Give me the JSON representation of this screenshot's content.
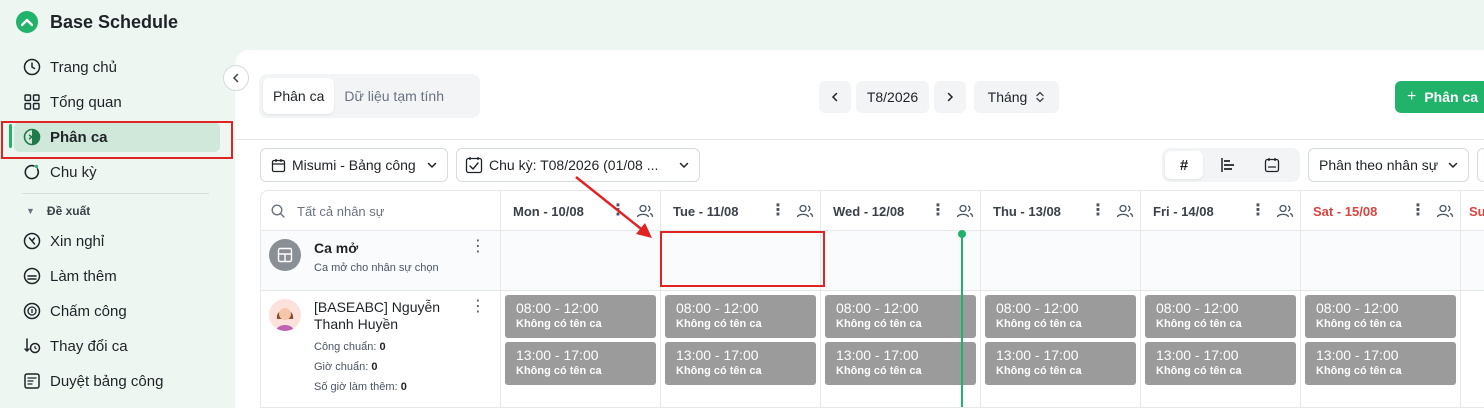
{
  "app": {
    "title": "Base Schedule"
  },
  "sidebar": {
    "items": [
      {
        "label": "Trang chủ",
        "icon": "clock-icon"
      },
      {
        "label": "Tổng quan",
        "icon": "grid-icon"
      },
      {
        "label": "Phân ca",
        "icon": "shift-icon",
        "active": true
      },
      {
        "label": "Chu kỳ",
        "icon": "cycle-icon"
      }
    ],
    "section_label": "Đề xuất",
    "section_items": [
      {
        "label": "Xin nghỉ",
        "icon": "leave-icon"
      },
      {
        "label": "Làm thêm",
        "icon": "overtime-icon"
      },
      {
        "label": "Chấm công",
        "icon": "timekeeping-icon"
      },
      {
        "label": "Thay đổi ca",
        "icon": "swap-shift-icon"
      },
      {
        "label": "Duyệt bảng công",
        "icon": "approve-timesheet-icon"
      }
    ]
  },
  "toolbar": {
    "tabs": [
      {
        "label": "Phân ca",
        "active": true
      },
      {
        "label": "Dữ liệu tạm tính",
        "active": false
      }
    ],
    "period": "T8/2026",
    "view_mode": "Tháng",
    "primary_button": "Phân ca"
  },
  "filters": {
    "timesheet": "Misumi - Bảng công",
    "cycle": "Chu kỳ: T08/2026 (01/08 ...",
    "group_by": "Phân theo nhân sự"
  },
  "grid": {
    "search_placeholder": "Tất cả nhân sự",
    "days": [
      {
        "label": "Mon - 10/08",
        "weekend": false
      },
      {
        "label": "Tue - 11/08",
        "weekend": false
      },
      {
        "label": "Wed - 12/08",
        "weekend": false
      },
      {
        "label": "Thu - 13/08",
        "weekend": false
      },
      {
        "label": "Fri - 14/08",
        "weekend": false
      },
      {
        "label": "Sat - 15/08",
        "weekend": true
      },
      {
        "label": "Su",
        "weekend": true
      }
    ],
    "open_shift": {
      "title": "Ca mở",
      "subtitle": "Ca mở cho nhân sự chọn"
    },
    "employee": {
      "name": "[BASEABC] Nguyễn Thanh Huyền",
      "stats": [
        {
          "label": "Công chuẩn:",
          "value": "0"
        },
        {
          "label": "Giờ chuẩn:",
          "value": "0"
        },
        {
          "label": "Số giờ làm thêm:",
          "value": "0"
        }
      ]
    },
    "shifts": [
      {
        "time": "08:00 - 12:00",
        "name": "Không có tên ca"
      },
      {
        "time": "13:00 - 17:00",
        "name": "Không có tên ca"
      }
    ]
  },
  "colors": {
    "accent": "#22b36a",
    "highlight": "#e02424",
    "shift_block": "#9b9b9b",
    "weekend": "#d9453d"
  }
}
